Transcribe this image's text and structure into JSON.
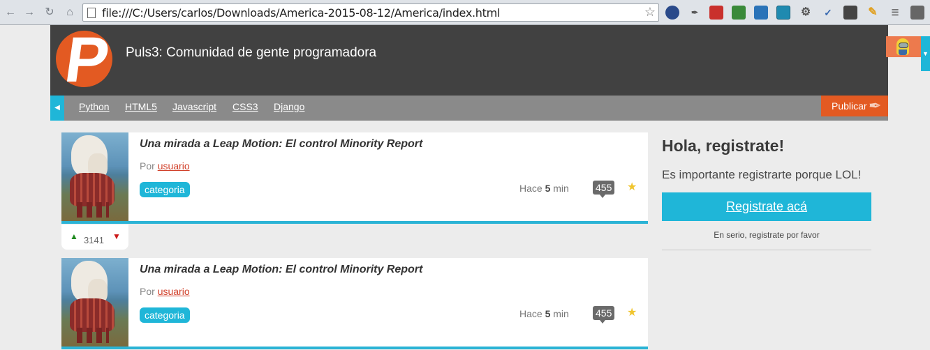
{
  "browser": {
    "url": "file:///C:/Users/carlos/Downloads/America-2015-08-12/America/index.html"
  },
  "header": {
    "logo_letter": "P",
    "title": "Puls3: Comunidad de gente programadora"
  },
  "nav": {
    "links": [
      "Python",
      "HTML5",
      "Javascript",
      "CSS3",
      "Django"
    ],
    "publish_label": "Publicar"
  },
  "posts": [
    {
      "title": "Una mirada a Leap Motion: El control Minority Report",
      "author_prefix": "Por",
      "author": "usuario",
      "category": "categoria",
      "time_prefix": "Hace",
      "time_value": "5",
      "time_unit": "min",
      "comments": "455",
      "votes": "3141"
    },
    {
      "title": "Una mirada a Leap Motion: El control Minority Report",
      "author_prefix": "Por",
      "author": "usuario",
      "category": "categoria",
      "time_prefix": "Hace",
      "time_value": "5",
      "time_unit": "min",
      "comments": "455"
    }
  ],
  "sidebar": {
    "heading": "Hola, registrate!",
    "text": "Es importante registrarte porque LOL!",
    "button": "Registrate acá",
    "note": "En serio, registrate por favor"
  },
  "colors": {
    "accent": "#1fb6d8",
    "brand_orange": "#e35a22",
    "header_bg": "#414141",
    "nav_bg": "#8a8a8a"
  }
}
